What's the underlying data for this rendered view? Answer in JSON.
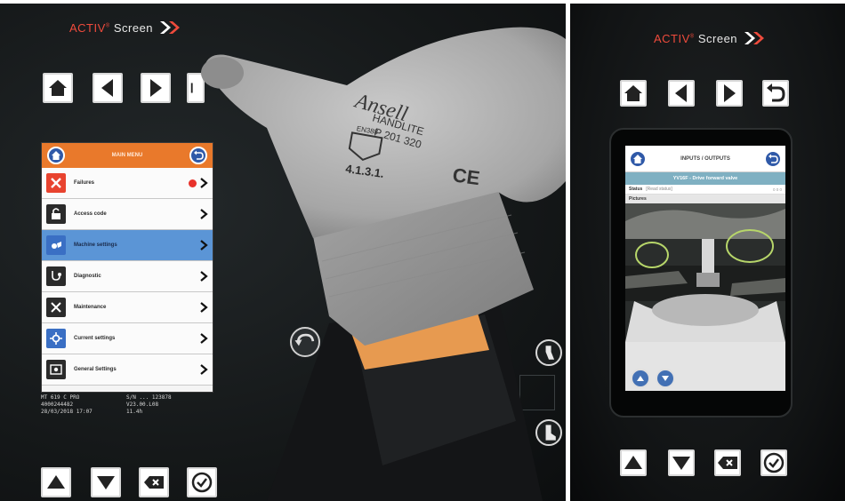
{
  "brand": {
    "activ": "ACTIV",
    "screen": "Screen"
  },
  "left_device": {
    "title": "MAIN MENU",
    "menu_items": [
      {
        "label": "Failures",
        "icon": "failures-icon",
        "selected": false,
        "alert": true,
        "icon_bg": "#e8432f"
      },
      {
        "label": "Access code",
        "icon": "lock-icon",
        "selected": false,
        "alert": false,
        "icon_bg": "#2b2b2b"
      },
      {
        "label": "Machine settings",
        "icon": "machine-settings-icon",
        "selected": true,
        "alert": false,
        "icon_bg": "#3a6fc4"
      },
      {
        "label": "Diagnostic",
        "icon": "stethoscope-icon",
        "selected": false,
        "alert": false,
        "icon_bg": "#2b2b2b"
      },
      {
        "label": "Maintenance",
        "icon": "tools-icon",
        "selected": false,
        "alert": false,
        "icon_bg": "#2b2b2b"
      },
      {
        "label": "Current settings",
        "icon": "current-settings-icon",
        "selected": false,
        "alert": false,
        "icon_bg": "#3a6fc4"
      },
      {
        "label": "General Settings",
        "icon": "general-settings-icon",
        "selected": false,
        "alert": false,
        "icon_bg": "#2b2b2b"
      }
    ],
    "status": [
      "MT 619 C PRO",
      "S/N ... 123878",
      "4000244482",
      "V23.00.L08",
      "28/03/2018 17:07",
      "11.4h"
    ]
  },
  "right_device": {
    "title": "INPUTS / OUTPUTS",
    "subtitle": "YV16F - Drive forward valve",
    "status_label": "Status",
    "status_value": "[Read status]",
    "status_right": "0 0 0",
    "pictures_label": "Pictures"
  },
  "glove_text": [
    "Ansell",
    "HANDLITE",
    "P 201 320",
    "EN388",
    "4.1.3.1.",
    "CE"
  ],
  "colors": {
    "orange_header": "#e9792b",
    "selected_row": "#5b95d6",
    "accent_blue": "#2f59a8",
    "brand_red": "#ef4b3c",
    "alert_red": "#e8322b"
  }
}
